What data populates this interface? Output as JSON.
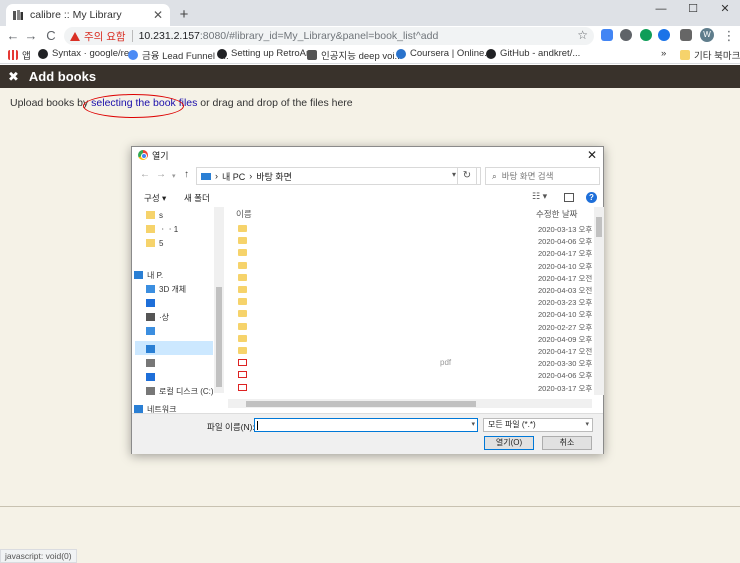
{
  "browser": {
    "tab_title": "calibre :: My Library",
    "new_tab": "+",
    "window_controls": [
      "—",
      "☐",
      "✕"
    ],
    "security_label": "주의 요함",
    "url_host": "10.231.2.157",
    "url_rest": ":8080/#library_id=My_Library&panel=book_list^add",
    "star": "☆",
    "nav": {
      "back": "←",
      "forward": "→",
      "reload": "C"
    }
  },
  "bookmarks": [
    {
      "label": "앱",
      "color": "#e53935"
    },
    {
      "label": "Syntax · google/re...",
      "color": "#202124"
    },
    {
      "label": "금융 Lead Funnel -...",
      "color": "#4c8bf5"
    },
    {
      "label": "Setting up RetroAr...",
      "color": "#202124"
    },
    {
      "label": "인공지능 deep voi...",
      "color": "#555555"
    },
    {
      "label": "Coursera | Online...",
      "color": "#2a73cc"
    },
    {
      "label": "GitHub - andkret/...",
      "color": "#202124"
    }
  ],
  "bookmarks_more": "»",
  "bookmarks_other": "기타 북마크",
  "calibre": {
    "close_x": "✖",
    "heading": "Add books",
    "upload_prefix": "Upload books by ",
    "upload_link": "selecting the book files",
    "upload_suffix": " or drag and drop of the files here",
    "status_text": "javascript: void(0)"
  },
  "dialog": {
    "title": "열기",
    "close": "✕",
    "path_root": "내 PC",
    "path_sep": "›",
    "path_folder": "바탕 화면",
    "search_placeholder": "바탕 화면 검색",
    "organize": "구성 ▾",
    "new_folder": "새 폴더",
    "col_name": "이름",
    "col_date": "수정한 날짜",
    "nav_items": [
      {
        "label": "s",
        "color": "#f6d36b"
      },
      {
        "label": "ㆍㆍ1",
        "color": "#f6d36b"
      },
      {
        "label": "5",
        "color": "#f6d36b"
      },
      {
        "label": "",
        "color": "#ffffff"
      },
      {
        "label": "내 P.",
        "color": "#2a7fd4"
      },
      {
        "label": "3D 개체",
        "color": "#3b8ee0"
      },
      {
        "label": "",
        "color": "#1e6fd9"
      },
      {
        "label": "",
        "color": "#555555"
      },
      {
        "label": "·상",
        "color": "#777777"
      },
      {
        "label": "",
        "color": "#3b8ee0"
      },
      {
        "label": "",
        "color": "#2a7fd4"
      },
      {
        "label": "",
        "color": "#1e6fd9"
      },
      {
        "label": "로컬 디스크 (C:)",
        "color": "#777777"
      },
      {
        "label": "네트워크",
        "color": "#2a7fd4"
      }
    ],
    "files": [
      {
        "name": "",
        "date": "2020-03-13 오후",
        "type": "folder"
      },
      {
        "name": "",
        "date": "2020-04-06 오후",
        "type": "folder"
      },
      {
        "name": "",
        "date": "2020-04-17 오후",
        "type": "folder"
      },
      {
        "name": "",
        "date": "2020-04-10 오후",
        "type": "folder"
      },
      {
        "name": "",
        "date": "2020-04-17 오전",
        "type": "folder"
      },
      {
        "name": "",
        "date": "2020-04-03 오전",
        "type": "folder"
      },
      {
        "name": "",
        "date": "2020-03-23 오후",
        "type": "folder"
      },
      {
        "name": "",
        "date": "2020-04-10 오후",
        "type": "folder"
      },
      {
        "name": "",
        "date": "2020-02-27 오후",
        "type": "folder"
      },
      {
        "name": "",
        "date": "2020-04-09 오후",
        "type": "folder"
      },
      {
        "name": "",
        "date": "2020-04-17 오전",
        "type": "folder"
      },
      {
        "name": "pdf",
        "date": "2020-03-30 오후",
        "type": "pdf"
      },
      {
        "name": "",
        "date": "2020-04-06 오후",
        "type": "pdf"
      },
      {
        "name": "",
        "date": "2020-03-17 오후",
        "type": "pdf"
      }
    ],
    "filename_label": "파일 이름(N):",
    "filename_value": "",
    "filetype_value": "모든 파일 (*.*)",
    "open_button": "열기(O)",
    "cancel_button": "취소"
  }
}
